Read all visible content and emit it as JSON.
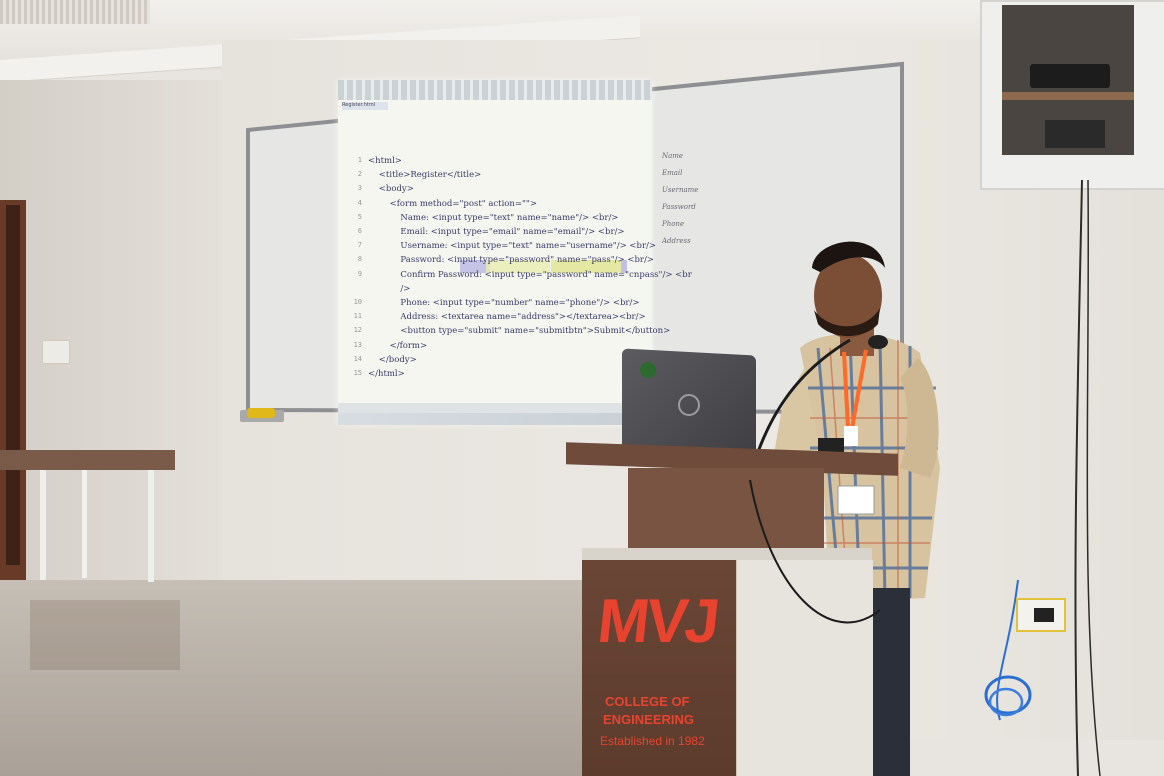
{
  "colors": {
    "wall": "#e9e5e0",
    "left_wall": "#d9d4cd",
    "ceiling": "#eeece8",
    "floor": "#b9b2aa",
    "whiteboard": "#e8e8e6",
    "projection": "#f4f6ef",
    "podium_wood": "#6b4a3a",
    "logo_red": "#e8432f",
    "shirt": "#d9c6a3",
    "laptop": "#4a4a4e"
  },
  "projection": {
    "tab_label": "Register.html",
    "code_lines": [
      {
        "num": "1",
        "text": "<html>"
      },
      {
        "num": "2",
        "text": "    <title>Register</title>"
      },
      {
        "num": "3",
        "text": "    <body>"
      },
      {
        "num": "4",
        "text": "        <form method=\"post\" action=\"\">"
      },
      {
        "num": "5",
        "text": "            Name: <input type=\"text\" name=\"name\"/> <br/>"
      },
      {
        "num": "6",
        "text": "            Email: <input type=\"email\" name=\"email\"/> <br/>"
      },
      {
        "num": "7",
        "text": "            Username: <input type=\"text\" name=\"username\"/> <br/>"
      },
      {
        "num": "8",
        "text": "            Password: <input type=\"password\" name=\"pass\"/> <br/>"
      },
      {
        "num": "9",
        "text": "            Confirm Password: <input type=\"password\" name=\"cnpass\"/> <br"
      },
      {
        "num": "",
        "text": "            />"
      },
      {
        "num": "10",
        "text": "            Phone: <input type=\"number\" name=\"phone\"/> <br/>"
      },
      {
        "num": "11",
        "text": "            Address: <textarea name=\"address\"></textarea><br/>"
      },
      {
        "num": "12",
        "text": "            <button type=\"submit\" name=\"submitbtn\">Submit</button>"
      },
      {
        "num": "13",
        "text": "        </form>"
      },
      {
        "num": "14",
        "text": "    </body>"
      },
      {
        "num": "15",
        "text": "</html>"
      }
    ]
  },
  "whiteboard_notes": [
    "Name",
    "Email",
    "Username",
    "Password",
    "Phone",
    "Address"
  ],
  "podium": {
    "logo": "MVJ",
    "line1": "COLLEGE OF",
    "line2": "ENGINEERING",
    "line3": "Established in 1982"
  }
}
